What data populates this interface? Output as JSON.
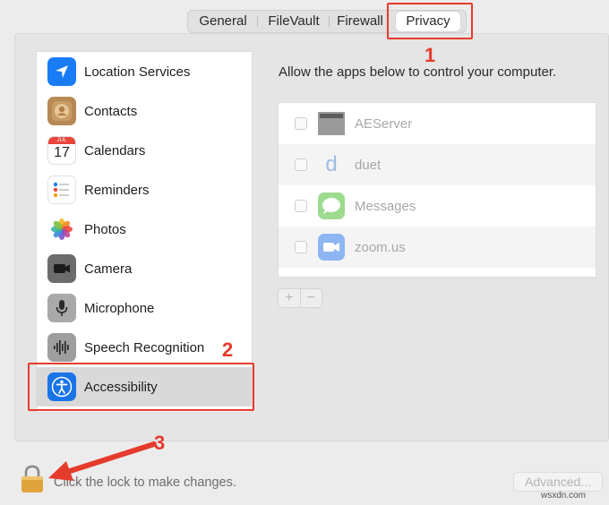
{
  "tabs": [
    {
      "label": "General"
    },
    {
      "label": "FileVault"
    },
    {
      "label": "Firewall"
    },
    {
      "label": "Privacy",
      "selected": true
    }
  ],
  "sidebar": {
    "items": [
      {
        "label": "Location Services",
        "icon": "location-arrow-icon"
      },
      {
        "label": "Contacts",
        "icon": "contacts-icon"
      },
      {
        "label": "Calendars",
        "icon": "calendar-icon",
        "icon_text": "17",
        "icon_month": "JUL"
      },
      {
        "label": "Reminders",
        "icon": "reminders-icon"
      },
      {
        "label": "Photos",
        "icon": "photos-icon"
      },
      {
        "label": "Camera",
        "icon": "camera-icon"
      },
      {
        "label": "Microphone",
        "icon": "microphone-icon"
      },
      {
        "label": "Speech Recognition",
        "icon": "waveform-icon"
      },
      {
        "label": "Accessibility",
        "icon": "accessibility-icon",
        "selected": true
      }
    ]
  },
  "content": {
    "description": "Allow the apps below to control your computer.",
    "apps": [
      {
        "name": "AEServer",
        "icon": "server-icon",
        "checked": false
      },
      {
        "name": "duet",
        "icon": "duet-icon",
        "icon_text": "d",
        "checked": false
      },
      {
        "name": "Messages",
        "icon": "messages-icon",
        "checked": false
      },
      {
        "name": "zoom.us",
        "icon": "zoom-icon",
        "checked": false
      }
    ],
    "add_label": "+",
    "remove_label": "−"
  },
  "footer": {
    "lock_text": "Click the lock to make changes.",
    "advanced_label": "Advanced..."
  },
  "annotations": {
    "one": "1",
    "two": "2",
    "three": "3"
  },
  "watermark": "wsxdn.com",
  "colors": {
    "annotation": "#e53b2c",
    "selected_row": "#d9d9d9",
    "location_blue": "#1a7cf5",
    "accessibility_blue": "#1a74e8",
    "lock_gold": "#e0a43c"
  }
}
